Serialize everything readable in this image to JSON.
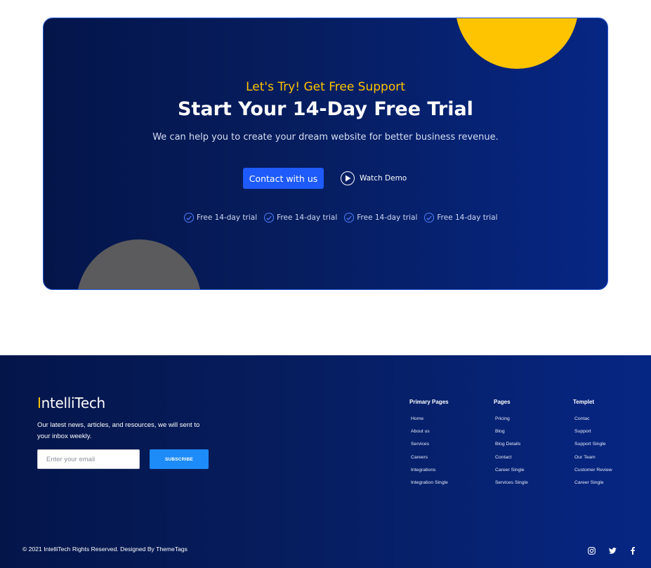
{
  "cta": {
    "subtitle": "Let's Try! Get Free Support",
    "title": "Start Your 14-Day Free Trial",
    "description": "We can help you to create your dream website for better business revenue.",
    "contact_label": "Contact with us",
    "watch_label": "Watch Demo",
    "features": [
      "Free 14-day trial",
      "Free 14-day trial",
      "Free 14-day trial",
      "Free 14-day trial"
    ]
  },
  "footer": {
    "logo_first": "I",
    "logo_rest": "ntelliTech",
    "newsletter_text": "Our latest news, articles, and resources, we will sent to your inbox weekly.",
    "email_placeholder": "Enter your email",
    "subscribe_label": "SUBSCRIBE",
    "columns": [
      {
        "title": "Primary Pages",
        "links": [
          "Home",
          "About us",
          "Services",
          "Careers",
          "Integrations",
          "Integration Single"
        ]
      },
      {
        "title": "Pages",
        "links": [
          "Pricing",
          "Blog",
          "Blog Details",
          "Contact",
          "Career Single",
          "Services Single"
        ]
      },
      {
        "title": "Templet",
        "links": [
          "Contac",
          "Support",
          "Support Single",
          "Our Team",
          "Customer Review",
          "Career  Single"
        ]
      }
    ],
    "copyright": "© 2021 IntelliTech Rights Reserved. Designed By ThemeTags",
    "social": [
      "instagram-icon",
      "twitter-icon",
      "facebook-icon"
    ]
  },
  "colors": {
    "accent_yellow": "#fec401",
    "primary_blue": "#1e5bfa",
    "subscribe_blue": "#1d8bf8",
    "navy_dark": "#04154a",
    "navy_light": "#062684"
  }
}
